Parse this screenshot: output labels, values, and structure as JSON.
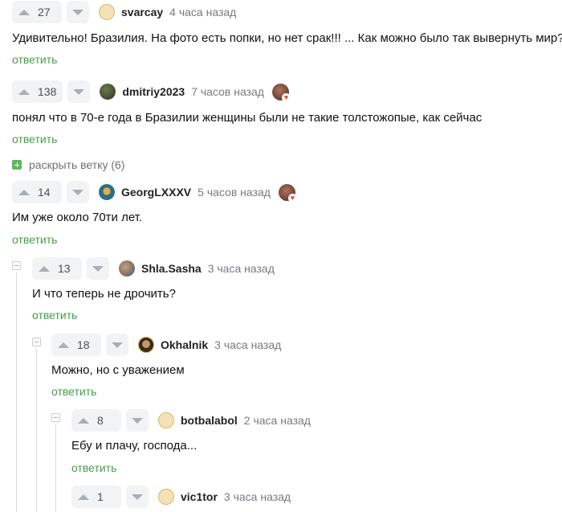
{
  "comments": [
    {
      "votes": "27",
      "user": "svarcay",
      "time": "4 часа назад",
      "text": "Удивительно! Бразилия. На фото есть попки, но нет срак!!! ... Как можно было так вывернуть мир?",
      "reply": "ответить"
    },
    {
      "votes": "138",
      "user": "dmitriy2023",
      "time": "7 часов назад",
      "text": "понял что в 70-е года в Бразилии женщины были не такие толстожопые, как сейчас",
      "reply": "ответить"
    },
    {
      "votes": "14",
      "user": "GeorgLXXXV",
      "time": "5 часов назад",
      "text": "Им уже около 70ти лет.",
      "reply": "ответить"
    },
    {
      "votes": "13",
      "user": "Shla.Sasha",
      "time": "3 часа назад",
      "text": "И что теперь не дрочить?",
      "reply": "ответить"
    },
    {
      "votes": "18",
      "user": "Okhalnik",
      "time": "3 часа назад",
      "text": "Можно, но с уважением",
      "reply": "ответить"
    },
    {
      "votes": "8",
      "user": "botbalabol",
      "time": "2 часа назад",
      "text": "Ебу и плачу, господа...",
      "reply": "ответить"
    },
    {
      "votes": "1",
      "user": "vic1tor",
      "time": "3 часа назад",
      "text": "",
      "reply": ""
    }
  ],
  "expand_thread": {
    "label": "раскрыть ветку (6)"
  },
  "colors": {
    "accent_green": "#43a047",
    "vote_bg": "#f2f3f5",
    "muted": "#777b82"
  }
}
